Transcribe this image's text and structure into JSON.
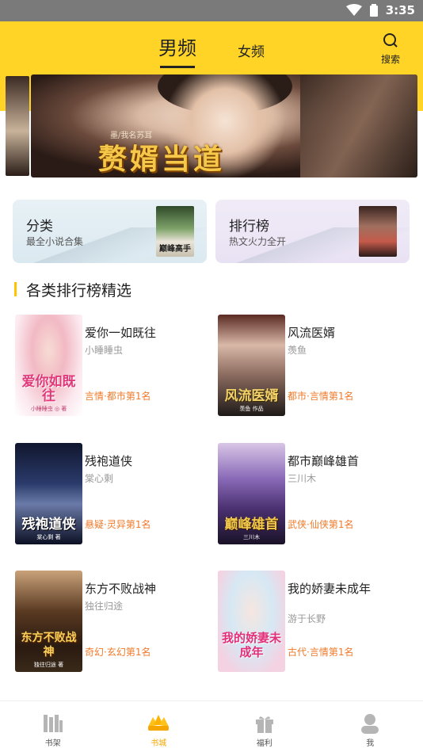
{
  "status_bar": {
    "time": "3:35"
  },
  "header": {
    "tabs": [
      {
        "label": "男频",
        "active": true
      },
      {
        "label": "女频",
        "active": false
      }
    ],
    "search_label": "搜索"
  },
  "banner": {
    "title": "赘婿当道",
    "subtitle": "墨/我名苏耳"
  },
  "quick_cards": [
    {
      "title": "分类",
      "subtitle": "最全小说合集",
      "thumb_text": "巅峰高手"
    },
    {
      "title": "排行榜",
      "subtitle": "热文火力全开"
    }
  ],
  "section": {
    "title": "各类排行榜精选"
  },
  "books": [
    {
      "name": "爱你一如既往",
      "author": "小睡睡虫",
      "rank": "言情·都市第1名",
      "cover_text": "爱你如既往",
      "cover_author": "小睡睡虫 ◎ 著"
    },
    {
      "name": "风流医婿",
      "author": "羡鱼",
      "rank": "都市·言情第1名",
      "cover_text": "风流医婿",
      "cover_author": "羡鱼 作品"
    },
    {
      "name": "残袍道侠",
      "author": "棠心剩",
      "rank": "悬疑·灵异第1名",
      "cover_text": "残袍道侠",
      "cover_author": "棠心剩 著"
    },
    {
      "name": "都市巅峰雄首",
      "author": "三川木",
      "rank": "武侠·仙侠第1名",
      "cover_text": "巅峰雄首",
      "cover_author": "三川木"
    },
    {
      "name": "东方不败战神",
      "author": "独往归途",
      "rank": "奇幻·玄幻第1名",
      "cover_text": "东方不败战神",
      "cover_author": "独往归途 著"
    },
    {
      "name": "我的娇妻未成年",
      "author": "游于长野",
      "rank": "古代·言情第1名",
      "cover_text": "我的娇妻未成年",
      "cover_author": ""
    }
  ],
  "bottom_nav": [
    {
      "label": "书架",
      "icon": "bookshelf-icon",
      "active": false
    },
    {
      "label": "书城",
      "icon": "bookstore-icon",
      "active": true
    },
    {
      "label": "福利",
      "icon": "gift-icon",
      "active": false
    },
    {
      "label": "我",
      "icon": "user-icon",
      "active": false
    }
  ],
  "colors": {
    "accent": "#ffd426",
    "rank_text": "#f07a2a",
    "nav_active": "#f5a600"
  }
}
